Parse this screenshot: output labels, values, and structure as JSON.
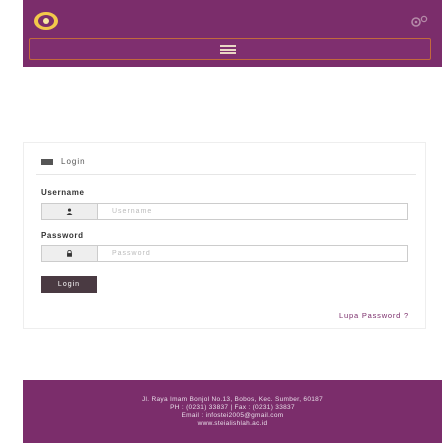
{
  "header": {
    "logo_icon": "university-logo",
    "settings_icon": "gear-icon",
    "menu_icon": "hamburger-icon"
  },
  "login": {
    "heading": "Login",
    "heading_icon": "list-icon",
    "username_label": "Username",
    "username_placeholder": "Username",
    "username_icon": "user-icon",
    "password_label": "Password",
    "password_placeholder": "Password",
    "password_icon": "lock-icon",
    "submit_label": "Login",
    "forgot_label": "Lupa Password ?"
  },
  "footer": {
    "address": "Jl. Raya Imam Bonjol No.13, Bobos, Kec. Sumber, 60187",
    "phone": "PH : (0231) 33837 | Fax : (0231) 33837",
    "email": "Email : infostei2005@gmail.com",
    "website": "www.steialishlah.ac.id"
  },
  "colors": {
    "brand": "#7b2d6b",
    "button": "#4a3a42",
    "nav_border": "#c2693c"
  }
}
